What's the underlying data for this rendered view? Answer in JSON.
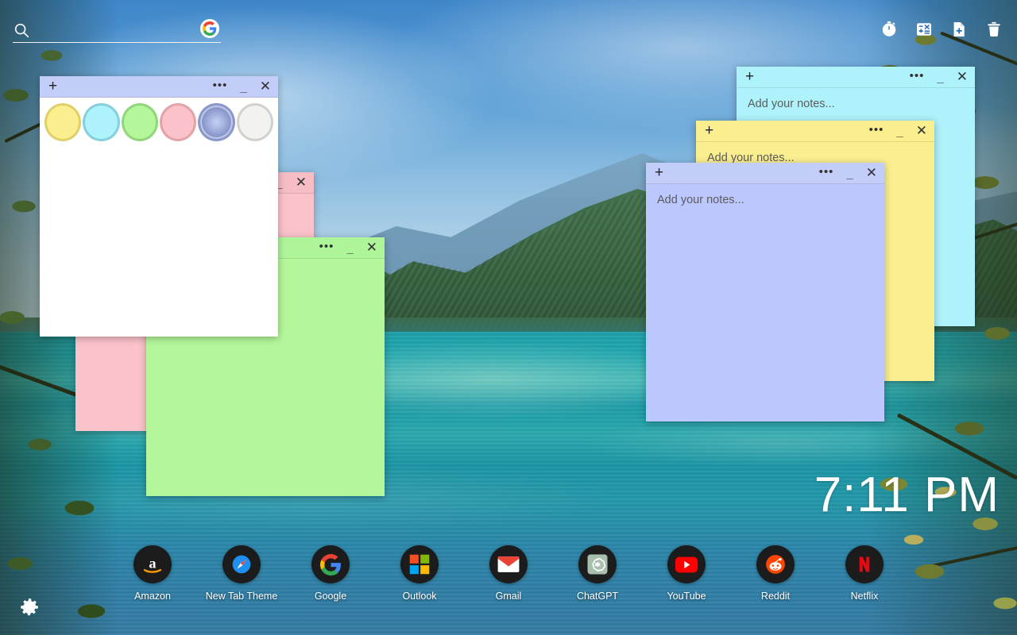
{
  "search": {
    "placeholder": "",
    "value": "",
    "icon": "search-icon",
    "engine_badge": "google-g-icon"
  },
  "top_tools": [
    {
      "name": "timer-icon",
      "label": "Timer"
    },
    {
      "name": "calculator-icon",
      "label": "Calculator"
    },
    {
      "name": "new-note-icon",
      "label": "New Note"
    },
    {
      "name": "trash-icon",
      "label": "Trash"
    }
  ],
  "palette": {
    "add_label": "+",
    "menu_label": "•••",
    "minimize_label": "_",
    "close_label": "✕",
    "titlebar_color": "#C2CDFA",
    "body_color": "#FFFFFF",
    "swatches": [
      {
        "name": "swatch-yellow",
        "color": "#FAEE8F",
        "border": "#DFD06B",
        "selected": false
      },
      {
        "name": "swatch-cyan",
        "color": "#AEF2FB",
        "border": "#86CFDC",
        "selected": false
      },
      {
        "name": "swatch-green",
        "color": "#B4F79A",
        "border": "#93D57C",
        "selected": false
      },
      {
        "name": "swatch-pink",
        "color": "#FAC3C9",
        "border": "#E2A3A9",
        "selected": false
      },
      {
        "name": "swatch-periwinkle",
        "color": "#8A98CC",
        "border": "#8A98CC",
        "selected": true
      },
      {
        "name": "swatch-white",
        "color": "#F2F2F0",
        "border": "#D3D1CE",
        "selected": false
      }
    ]
  },
  "notes": [
    {
      "name": "note-pink",
      "placeholder": "",
      "titlebar_color": "#F6BDC4",
      "body_color": "#FAC3C9",
      "menu_label": "•••",
      "minimize_label": "_",
      "close_label": "✕",
      "add_label": "+"
    },
    {
      "name": "note-green",
      "placeholder": "",
      "titlebar_color": "#AEF59A",
      "body_color": "#B4F79A",
      "menu_label": "•••",
      "minimize_label": "_",
      "close_label": "✕",
      "add_label": "+"
    },
    {
      "name": "note-cyan",
      "placeholder": "Add your notes...",
      "titlebar_color": "#AEF2FB",
      "body_color": "#AEF2FB",
      "menu_label": "•••",
      "minimize_label": "_",
      "close_label": "✕",
      "add_label": "+"
    },
    {
      "name": "note-yellow",
      "placeholder": "Add your notes...",
      "titlebar_color": "#FAEE8F",
      "body_color": "#FAEE8F",
      "menu_label": "•••",
      "minimize_label": "_",
      "close_label": "✕",
      "add_label": "+"
    },
    {
      "name": "note-periwinkle",
      "placeholder": "Add your notes...",
      "titlebar_color": "#C2CDFA",
      "body_color": "#BBC7FD",
      "menu_label": "•••",
      "minimize_label": "_",
      "close_label": "✕",
      "add_label": "+"
    }
  ],
  "clock": {
    "time": "7:11 PM"
  },
  "dock": {
    "items": [
      {
        "label": "Amazon",
        "icon": "amazon-icon"
      },
      {
        "label": "New Tab Theme",
        "icon": "new-tab-theme-icon"
      },
      {
        "label": "Google",
        "icon": "google-icon"
      },
      {
        "label": "Outlook",
        "icon": "outlook-icon"
      },
      {
        "label": "Gmail",
        "icon": "gmail-icon"
      },
      {
        "label": "ChatGPT",
        "icon": "chatgpt-icon"
      },
      {
        "label": "YouTube",
        "icon": "youtube-icon"
      },
      {
        "label": "Reddit",
        "icon": "reddit-icon"
      },
      {
        "label": "Netflix",
        "icon": "netflix-icon"
      }
    ]
  },
  "settings": {
    "icon": "gear-icon",
    "label": "Settings"
  }
}
